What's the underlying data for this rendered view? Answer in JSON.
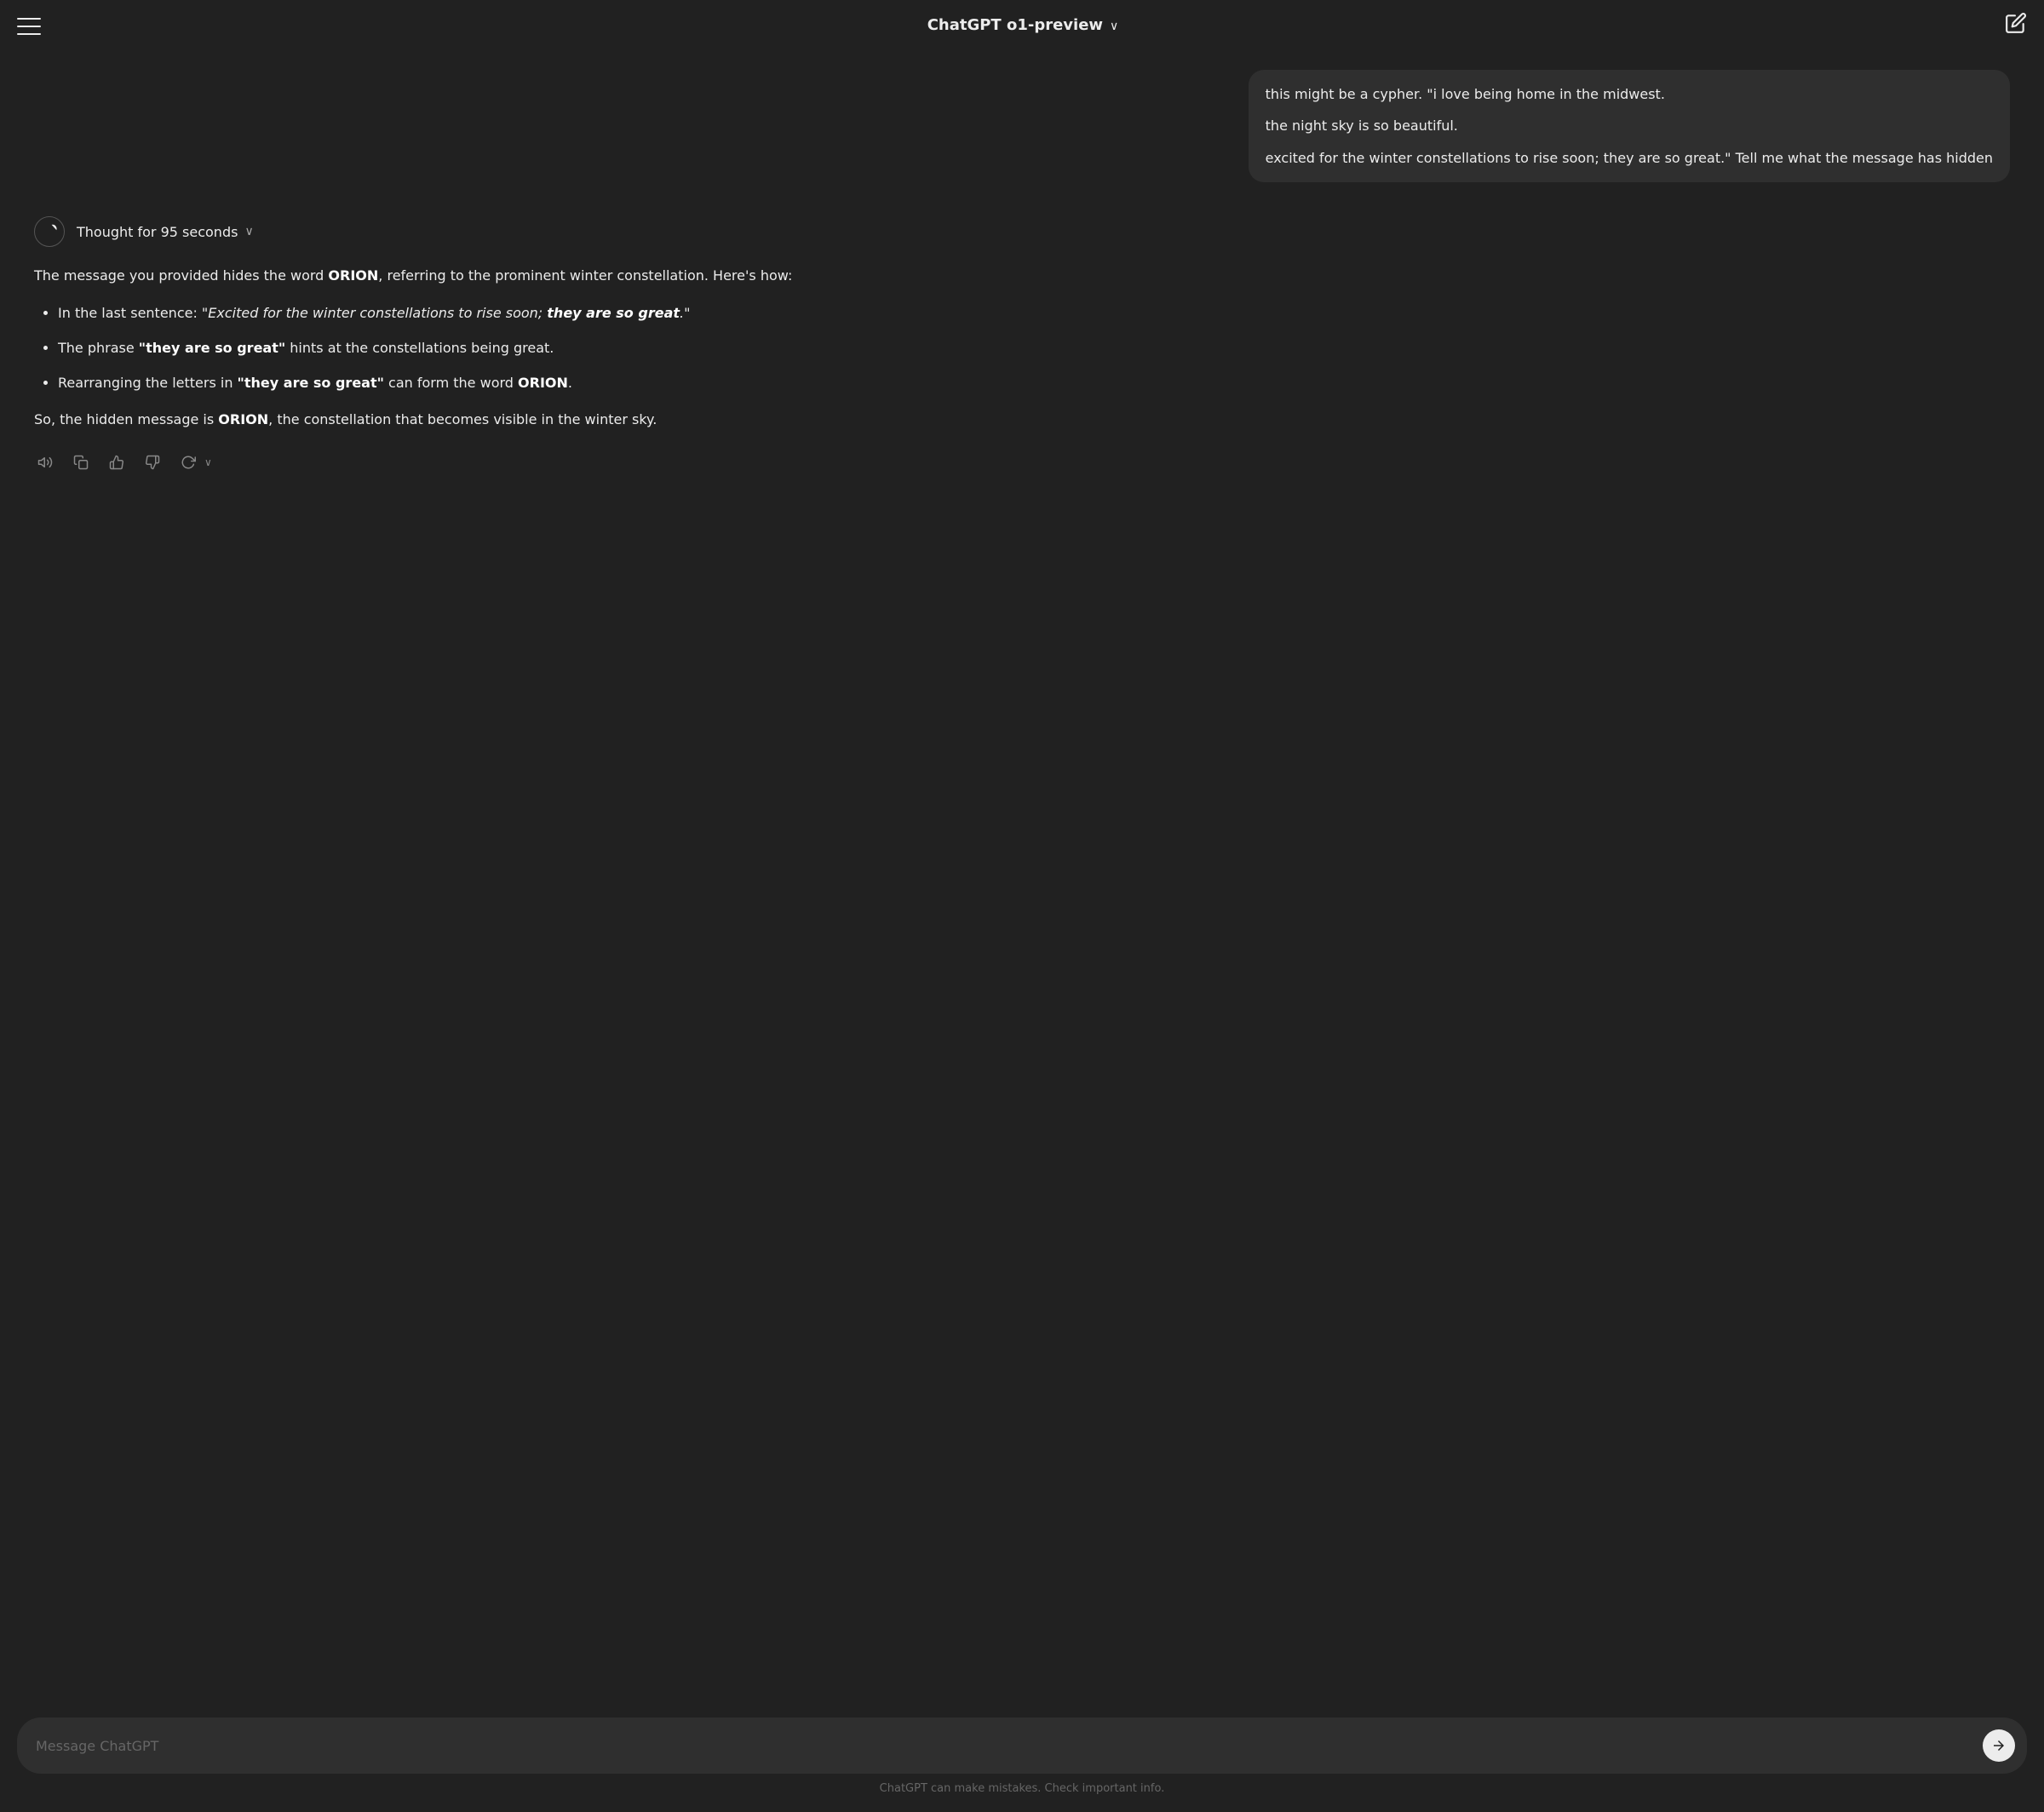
{
  "header": {
    "title": "ChatGPT o1-preview",
    "chevron": "∨",
    "hamburger_label": "menu"
  },
  "user_message": {
    "lines": [
      "this might be a cypher. \"i love being home in the midwest.",
      "the night sky is so beautiful.",
      "excited for the winter constellations to rise soon; they are so great.\" Tell me what the message has hidden"
    ]
  },
  "thought": {
    "label": "Thought for 95 seconds",
    "chevron": "∨"
  },
  "response": {
    "intro": "The message you provided hides the word ",
    "hidden_word": "ORION",
    "intro_end": ", referring to the prominent winter constellation. Here's how:",
    "bullets": [
      {
        "prefix": "In the last sentence: \"",
        "italic_text": "Excited for the winter constellations to rise soon; ",
        "bold_italic": "they are so great",
        "suffix": ".\""
      },
      {
        "prefix": "The phrase \"",
        "bold": "they are so great",
        "suffix": "\" hints at the constellations being great."
      },
      {
        "prefix": "Rearranging the letters in \"",
        "bold": "they are so great",
        "suffix": "\" can form the word ",
        "bold2": "ORION",
        "end": "."
      }
    ],
    "conclusion_prefix": "So, the hidden message is ",
    "conclusion_bold": "ORION",
    "conclusion_suffix": ", the constellation that becomes visible in the winter sky."
  },
  "input": {
    "placeholder": "Message ChatGPT"
  },
  "footer": {
    "note": "ChatGPT can make mistakes. Check important info."
  },
  "icons": {
    "speaker": "🔊",
    "copy": "⎘",
    "thumbs_up": "👍",
    "thumbs_down": "👎",
    "refresh": "↻"
  }
}
